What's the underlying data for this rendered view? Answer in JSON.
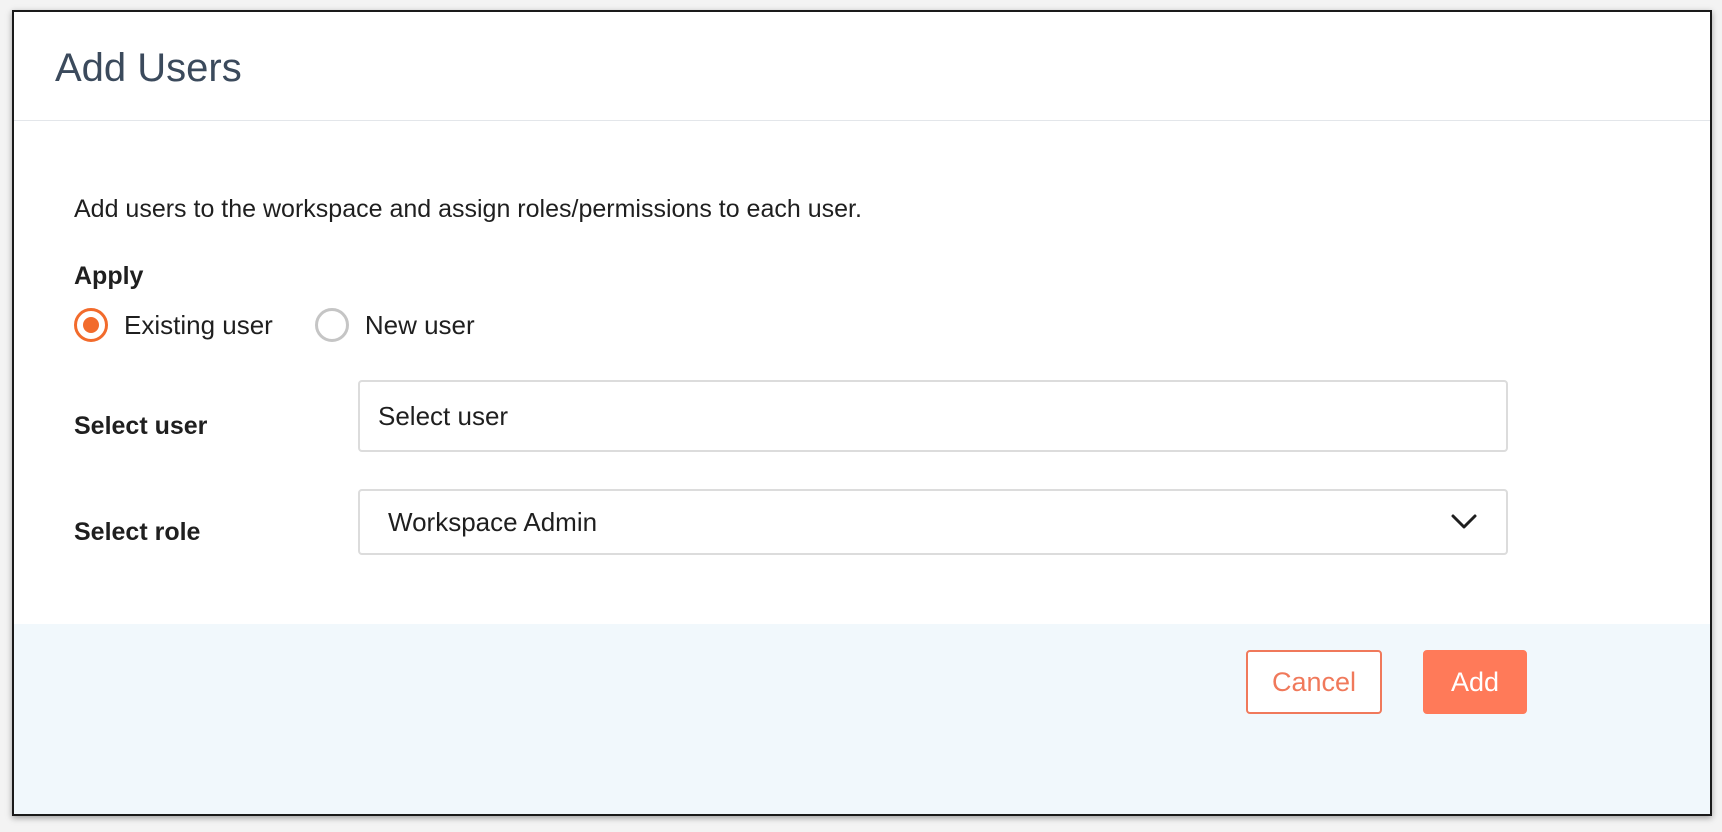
{
  "dialog": {
    "title": "Add Users",
    "description": "Add users to the workspace and assign roles/permissions to each user.",
    "apply_label": "Apply",
    "radio_options": [
      {
        "label": "Existing user",
        "checked": true
      },
      {
        "label": "New user",
        "checked": false
      }
    ],
    "select_user": {
      "label": "Select user",
      "placeholder": "Select user",
      "value": ""
    },
    "select_role": {
      "label": "Select role",
      "value": "Workspace Admin"
    },
    "buttons": {
      "cancel": "Cancel",
      "add": "Add"
    }
  },
  "colors": {
    "accent": "#f26b2c",
    "primary_button": "#ff7a59",
    "footer_background": "#f1f8fc",
    "title_text": "#3b4a5c"
  },
  "icons": {
    "dropdown": "chevron-down-icon"
  }
}
